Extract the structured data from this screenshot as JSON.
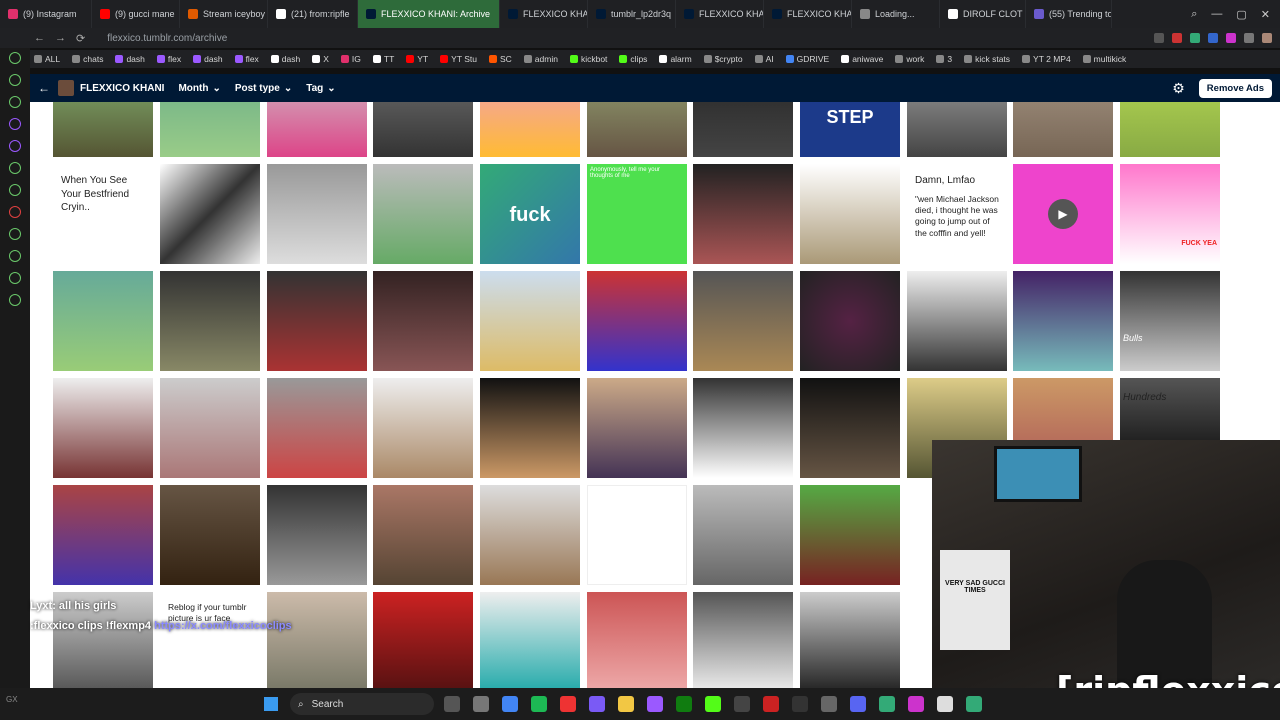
{
  "browser": {
    "tabs": [
      {
        "label": "(9) Instagram",
        "color": "#e1306c",
        "active": false
      },
      {
        "label": "(9) gucci mane",
        "color": "#ff0000",
        "active": false
      },
      {
        "label": "Stream iceyboy",
        "color": "#e05a00",
        "active": false
      },
      {
        "label": "(21) from:ripfle",
        "color": "#ffffff",
        "active": false
      },
      {
        "label": "FLEXXICO KHANI: Archive",
        "color": "#001935",
        "active": true
      },
      {
        "label": "FLEXXICO KHA",
        "color": "#001935",
        "active": false
      },
      {
        "label": "tumblr_lp2dr3q",
        "color": "#001935",
        "active": false
      },
      {
        "label": "FLEXXICO KHA",
        "color": "#001935",
        "active": false
      },
      {
        "label": "FLEXXICO KHA",
        "color": "#001935",
        "active": false
      },
      {
        "label": "Loading...",
        "color": "#888888",
        "active": false
      },
      {
        "label": "DIROLF CLOT",
        "color": "#ffffff",
        "active": false
      },
      {
        "label": "(55) Trending to",
        "color": "#6a5acd",
        "active": false
      }
    ],
    "url": "flexxico.tumblr.com/archive",
    "bookmarks": [
      {
        "label": "ALL",
        "color": "#888888"
      },
      {
        "label": "chats",
        "color": "#888888"
      },
      {
        "label": "dash",
        "color": "#9b59ff"
      },
      {
        "label": "flex",
        "color": "#9b59ff"
      },
      {
        "label": "dash",
        "color": "#9b59ff"
      },
      {
        "label": "flex",
        "color": "#9b59ff"
      },
      {
        "label": "dash",
        "color": "#ffffff"
      },
      {
        "label": "X",
        "color": "#ffffff"
      },
      {
        "label": "IG",
        "color": "#e1306c"
      },
      {
        "label": "TT",
        "color": "#ffffff"
      },
      {
        "label": "YT",
        "color": "#ff0000"
      },
      {
        "label": "YT Stu",
        "color": "#ff0000"
      },
      {
        "label": "SC",
        "color": "#ff5500"
      },
      {
        "label": "admin",
        "color": "#888888"
      },
      {
        "label": "kickbot",
        "color": "#53fc18"
      },
      {
        "label": "clips",
        "color": "#53fc18"
      },
      {
        "label": "alarm",
        "color": "#ffffff"
      },
      {
        "label": "$crypto",
        "color": "#888888"
      },
      {
        "label": "AI",
        "color": "#888888"
      },
      {
        "label": "GDRIVE",
        "color": "#4285f4"
      },
      {
        "label": "aniwave",
        "color": "#ffffff"
      },
      {
        "label": "work",
        "color": "#888888"
      },
      {
        "label": "3",
        "color": "#888888"
      },
      {
        "label": "kick stats",
        "color": "#888888"
      },
      {
        "label": "YT 2 MP4",
        "color": "#888888"
      },
      {
        "label": "multikick",
        "color": "#888888"
      }
    ]
  },
  "tumblr": {
    "blog_name": "FLEXXICO KHANI",
    "filters": [
      "Month",
      "Post type",
      "Tag"
    ],
    "remove_ads": "Remove Ads"
  },
  "grid": {
    "text_posts": [
      {
        "id": "t1",
        "text": "When You See Your Bestfriend Cryin.."
      },
      {
        "id": "t2",
        "text": "Damn, Lmfao"
      },
      {
        "id": "t3",
        "text": "\"wen Michael Jackson died, i thought he was going to jump out of the cofffin and yell!"
      },
      {
        "id": "t4",
        "text": "Reblog if your tumblr picture is ur face"
      }
    ],
    "image_words": [
      {
        "id": "w1",
        "text": "fuck"
      },
      {
        "id": "w2",
        "text": "Anonymously, tell me your thoughts of me"
      },
      {
        "id": "w3",
        "text": "STEP"
      },
      {
        "id": "w4",
        "text": "FUCK YEA"
      },
      {
        "id": "w5",
        "text": "Bulls"
      },
      {
        "id": "w6",
        "text": "Hundreds"
      }
    ]
  },
  "overlays": {
    "chat_line": "Lyxt: all his girls",
    "clips_line": ":flexxico clips !flexmp4",
    "clips_link": "https://x.com/flexxicoclips",
    "brand": "[ripflexxico]",
    "webcam_shirt_text": "VERY SAD GUCCI TIMES"
  },
  "taskbar": {
    "search_label": "Search",
    "gx_label": "GX"
  }
}
